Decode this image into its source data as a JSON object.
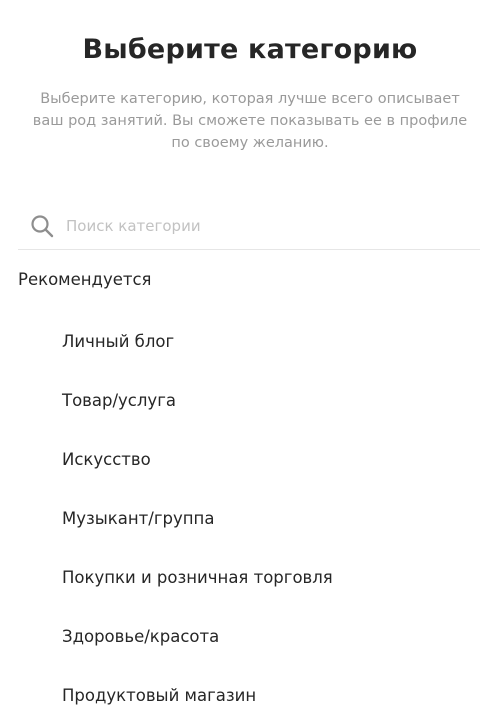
{
  "header": {
    "title": "Выберите категорию",
    "subtitle": "Выберите категорию, которая лучше всего описывает ваш род занятий. Вы сможете показывать ее в профиле по своему желанию."
  },
  "search": {
    "placeholder": "Поиск категории",
    "value": "",
    "icon": "search-icon"
  },
  "section": {
    "title": "Рекомендуется"
  },
  "categories": [
    {
      "label": "Личный блог"
    },
    {
      "label": "Товар/услуга"
    },
    {
      "label": "Искусство"
    },
    {
      "label": "Музыкант/группа"
    },
    {
      "label": "Покупки и розничная торговля"
    },
    {
      "label": "Здоровье/красота"
    },
    {
      "label": "Продуктовый магазин"
    }
  ],
  "colors": {
    "text": "#262626",
    "muted": "#9a9a9a",
    "placeholder": "#c2c2c2",
    "divider": "#e6e6e6"
  }
}
